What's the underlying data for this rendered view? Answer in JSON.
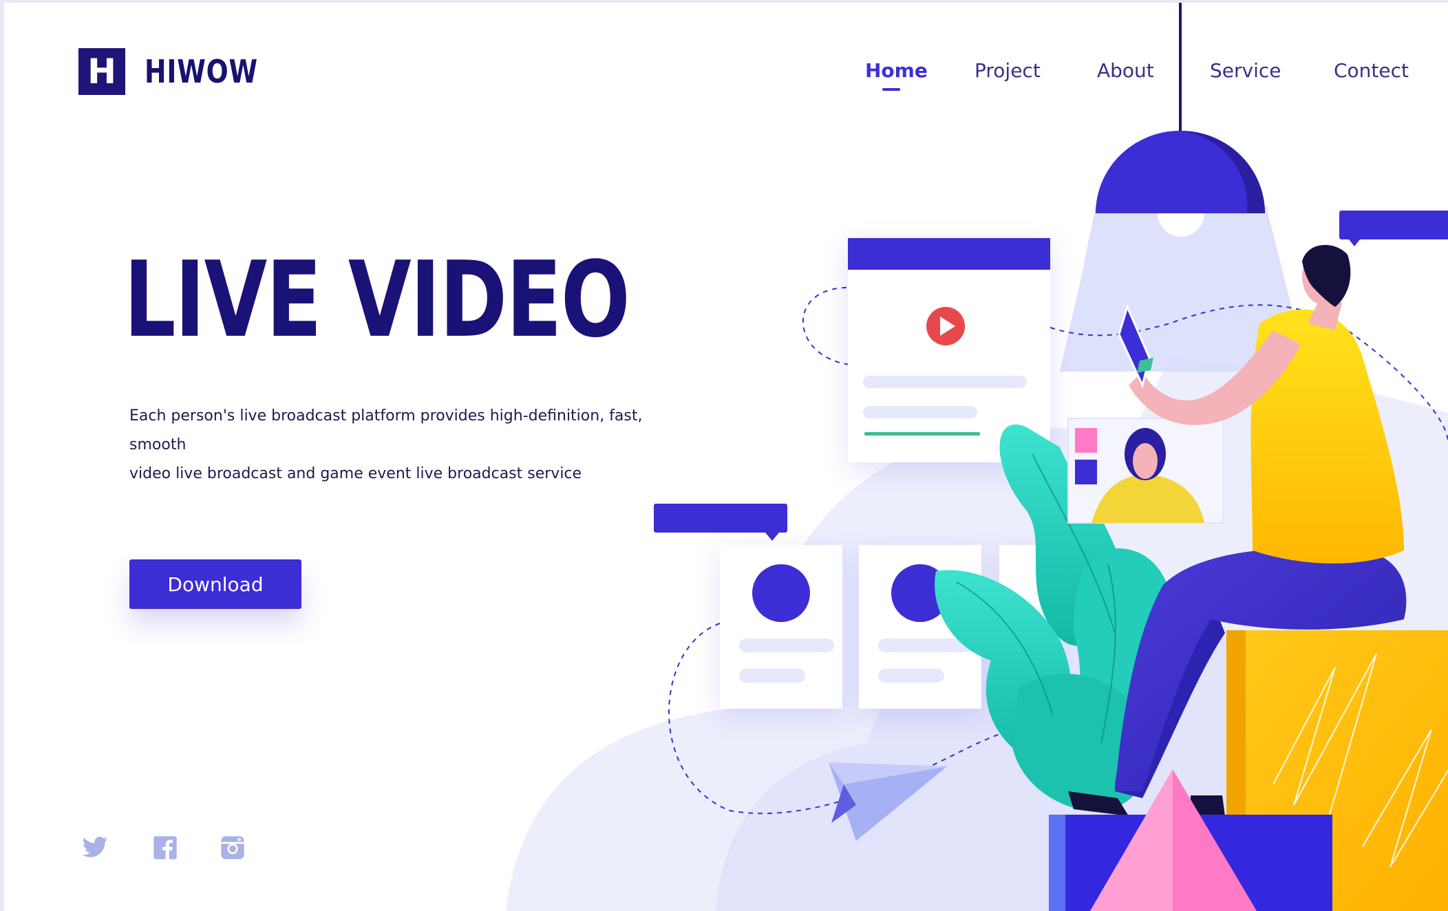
{
  "brand": {
    "logo_letter": "H",
    "name": "HIWOW"
  },
  "nav": {
    "items": [
      {
        "label": "Home",
        "active": true
      },
      {
        "label": "Project",
        "active": false
      },
      {
        "label": "About",
        "active": false
      },
      {
        "label": "Service",
        "active": false
      },
      {
        "label": "Contect",
        "active": false
      }
    ]
  },
  "hero": {
    "title": "LIVE VIDEO",
    "description_line1": "Each person's live broadcast platform provides high-definition, fast, smooth",
    "description_line2": "video live broadcast and game event live broadcast service",
    "cta_label": "Download"
  },
  "social": [
    {
      "icon": "twitter-icon"
    },
    {
      "icon": "facebook-icon"
    },
    {
      "icon": "instagram-icon"
    }
  ],
  "colors": {
    "primary": "#3d2dd5",
    "navy": "#1b1277",
    "accent_yellow": "#ffc400",
    "accent_teal": "#2fd6c3",
    "accent_pink": "#ff7ac4",
    "play_red": "#e8484b"
  }
}
